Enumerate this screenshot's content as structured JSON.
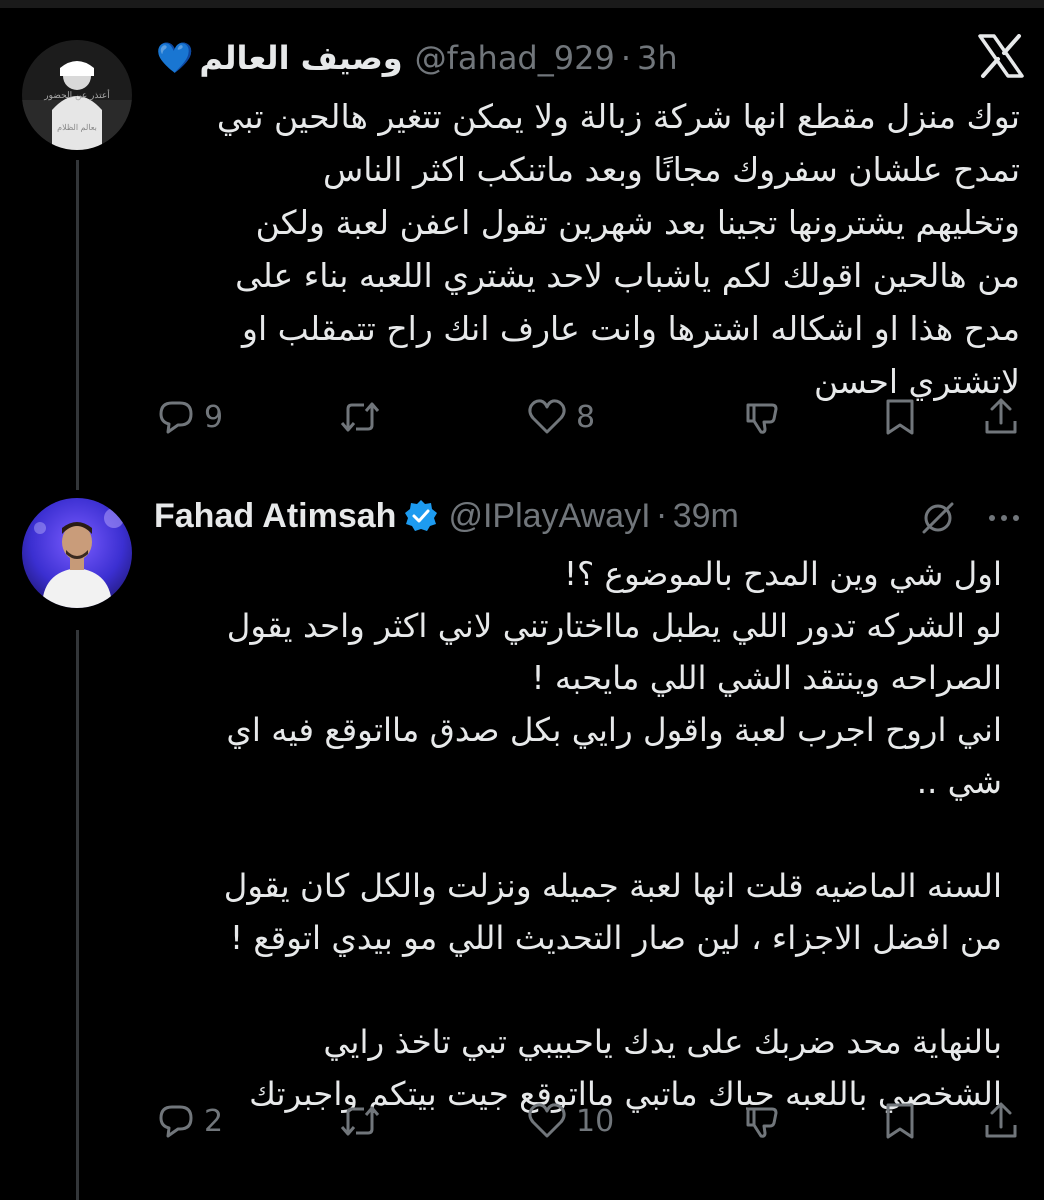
{
  "colors": {
    "background": "#000000",
    "text_primary": "#e7e9ea",
    "text_secondary": "#71767b",
    "verified_badge": "#1d9bf0",
    "heart_emoji": "#1d9bf0"
  },
  "icons": {
    "app": "x-logo-icon",
    "reply": "speech-bubble-icon",
    "repost": "repost-arrows-icon",
    "like": "heart-outline-icon",
    "dislike": "thumbs-down-icon",
    "bookmark": "bookmark-icon",
    "share": "share-upload-icon",
    "grok": "grok-icon",
    "more": "more-dots-icon",
    "verified": "verified-check-icon"
  },
  "tweet1": {
    "display_name": "وصيف العالم",
    "name_emoji": "💙",
    "handle": "@fahad_929",
    "separator": "·",
    "time": "3h",
    "text": "توك منزل مقطع انها شركة زبالة ولا يمكن تتغير هالحين تبي\nتمدح علشان سفروك مجانًا وبعد ماتنكب اكثر الناس\nوتخليهم يشترونها تجينا بعد شهرين تقول اعفن لعبة ولكن\nمن هالحين اقولك لكم ياشباب لاحد يشتري اللعبه بناء على\nمدح هذا او اشكاله اشترها وانت عارف انك راح تتمقلب او\nلاتشتري احسن",
    "reply_count": "9",
    "repost_count": "",
    "like_count": "8"
  },
  "tweet2": {
    "display_name": "Fahad Atimsah",
    "handle": "@IPlayAwayI",
    "separator": "·",
    "time": "39m",
    "text": "اول شي وين المدح بالموضوع ؟!\nلو الشركه تدور اللي يطبل مااختارتني لاني اكثر واحد يقول\nالصراحه وينتقد الشي اللي مايحبه !\nاني اروح اجرب لعبة واقول رايي بكل صدق مااتوقع فيه اي\nشي ..\n\nالسنه الماضيه قلت انها لعبة جميله ونزلت والكل كان يقول\nمن افضل الاجزاء ، لين صار التحديث اللي مو بيدي اتوقع !\n\nبالنهاية محد ضربك على يدك ياحبيبي تبي تاخذ رايي\nالشخصي باللعبه حياك ماتبي مااتوقع جيت بيتكم واجبرتك",
    "reply_count": "2",
    "repost_count": "",
    "like_count": "10"
  }
}
